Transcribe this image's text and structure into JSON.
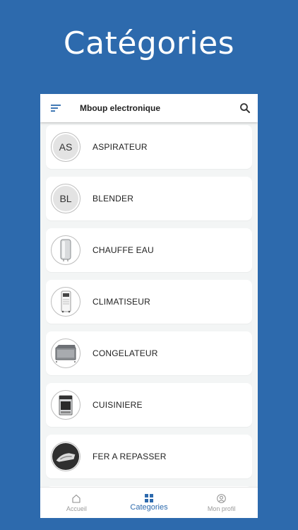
{
  "hero": {
    "title": "Catégories"
  },
  "appbar": {
    "title": "Mboup electronique",
    "menu_icon": "sort-menu-icon",
    "search_icon": "search-icon"
  },
  "categories": [
    {
      "label": "ASPIRATEUR",
      "initials": "AS",
      "icon": "initials-avatar"
    },
    {
      "label": "BLENDER",
      "initials": "BL",
      "icon": "initials-avatar"
    },
    {
      "label": "CHAUFFE EAU",
      "icon": "water-heater-image"
    },
    {
      "label": "CLIMATISEUR",
      "icon": "air-conditioner-image"
    },
    {
      "label": "CONGELATEUR",
      "icon": "freezer-image"
    },
    {
      "label": "CUISINIERE",
      "icon": "cooker-image"
    },
    {
      "label": "FER A REPASSER",
      "icon": "iron-image"
    }
  ],
  "tabs": [
    {
      "label": "Accueil",
      "icon": "home-icon",
      "active": false
    },
    {
      "label": "Categories",
      "icon": "grid-icon",
      "active": true
    },
    {
      "label": "Mon profil",
      "icon": "profile-icon",
      "active": false
    }
  ],
  "colors": {
    "brand": "#2d6aad",
    "background": "#f3f5f5",
    "text": "#222222"
  }
}
